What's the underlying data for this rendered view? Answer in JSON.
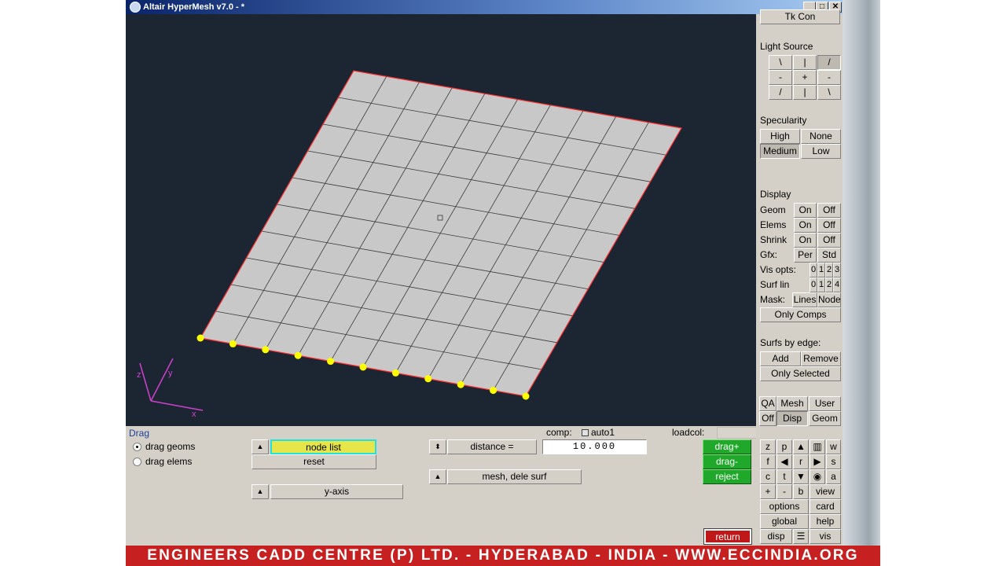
{
  "window": {
    "title": "Altair HyperMesh v7.0 - *",
    "min": "_",
    "max": "□",
    "close": "✕"
  },
  "side": {
    "top_button": "Tk Con",
    "light_source": {
      "title": "Light Source",
      "buttons": [
        "\\",
        "|",
        "/",
        "-",
        "+",
        "-",
        "/",
        "|",
        "\\"
      ]
    },
    "specularity": {
      "title": "Specularity",
      "high": "High",
      "none": "None",
      "medium": "Medium",
      "low": "Low"
    },
    "display": {
      "title": "Display",
      "geom": "Geom",
      "elems": "Elems",
      "shrink": "Shrink",
      "gfx": "Gfx:",
      "vis_opts": "Vis opts:",
      "surf_lin": "Surf lin",
      "mask": "Mask:",
      "on": "On",
      "off": "Off",
      "per": "Per",
      "std": "Std",
      "vis_nums": [
        "0",
        "1",
        "2",
        "3"
      ],
      "surf_nums": [
        "0",
        "1",
        "2",
        "4"
      ],
      "lines": "Lines",
      "node": "Node",
      "only_comps": "Only Comps"
    },
    "surfs_by_edge": {
      "title": "Surfs by edge:",
      "add": "Add",
      "remove": "Remove",
      "only_selected": "Only Selected"
    },
    "tabs": {
      "qa": "QA",
      "mesh": "Mesh",
      "user": "User",
      "off": "Off",
      "disp": "Disp",
      "geom": "Geom"
    }
  },
  "bottom": {
    "panel_name": "Drag",
    "comp_label": "comp:",
    "comp_value": "auto1",
    "loadcol_label": "loadcol:",
    "drag_geoms": "drag geoms",
    "drag_elems": "drag elems",
    "node_list": "node list",
    "reset": "reset",
    "y_axis": "y-axis",
    "distance": "distance =",
    "distance_value": "10.000",
    "mesh_dele": "mesh, dele surf",
    "drag_plus": "drag+",
    "drag_minus": "drag-",
    "reject": "reject",
    "return": "return",
    "nav": {
      "z": "z",
      "p": "p",
      "w": "w",
      "f": "f",
      "r": "r",
      "s": "s",
      "c": "c",
      "t": "t",
      "a": "a",
      "plus": "+",
      "minus": "-",
      "b": "b",
      "view": "view",
      "options": "options",
      "card": "card",
      "global": "global",
      "help": "help",
      "disp": "disp",
      "vis": "vis"
    }
  },
  "axes": {
    "z": "z",
    "y": "y",
    "x": "x"
  },
  "banner": "ENGINEERS CADD CENTRE (P) LTD. - HYDERABAD - INDIA - WWW.ECCINDIA.ORG",
  "colors": {
    "viewport": "#1c2633",
    "mesh": "#c8c8c8",
    "edge": "#ff3030",
    "nodes": "#ffff00",
    "banner": "#c62020"
  }
}
